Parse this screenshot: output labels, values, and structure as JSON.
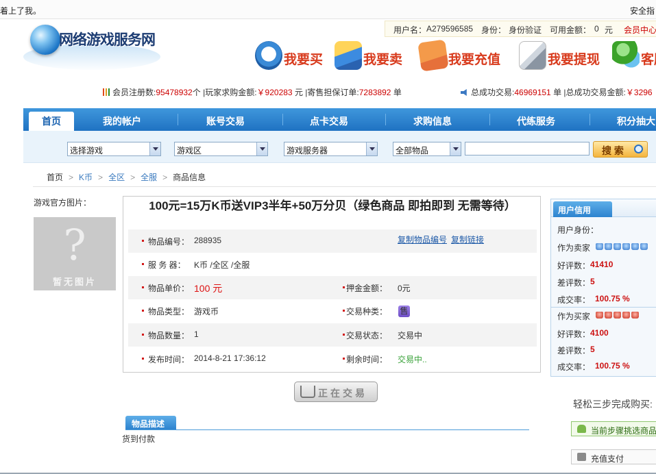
{
  "topbar": {
    "marquee": "着上了我。",
    "safety": "安全指"
  },
  "logo": {
    "name": "网络游戏服务网"
  },
  "user": {
    "username_label": "用户名：",
    "username": "A279596585",
    "identity_label": "身份：",
    "identity": "身份验证",
    "balance_label": "可用金额：",
    "balance": "0",
    "balance_unit": "元",
    "member_center": "会员中心"
  },
  "actions": [
    {
      "label": "我要买",
      "icon": "clock-dollar-icon"
    },
    {
      "label": "我要卖",
      "icon": "wallet-card-icon"
    },
    {
      "label": "我要充值",
      "icon": "id-card-icon"
    },
    {
      "label": "我要提现",
      "icon": "document-pen-icon"
    },
    {
      "label": "客服",
      "icon": "service-person-icon"
    }
  ],
  "stats": {
    "members_label": "会员注册数:",
    "members": "95478932",
    "members_unit": "个",
    "buy_label": "玩家求购金额:",
    "buy_amount": "￥920283",
    "buy_unit": "元",
    "escrow_label": "寄售担保订单:",
    "escrow": "7283892",
    "escrow_unit": "单",
    "success_label": "总成功交易:",
    "success": "46969151",
    "success_unit": "单",
    "success_amount_label": "总成功交易金额:",
    "success_amount": "￥3296"
  },
  "nav": [
    "首页",
    "我的帐户",
    "账号交易",
    "点卡交易",
    "求购信息",
    "代练服务",
    "积分抽大"
  ],
  "search": {
    "game": "选择游戏",
    "zone": "游戏区",
    "server": "游戏服务器",
    "category": "全部物品",
    "query": "",
    "button": "搜 索"
  },
  "breadcrumb": [
    "首页",
    "K币",
    "全区",
    "全服",
    "商品信息"
  ],
  "left": {
    "title": "游戏官方图片：",
    "placeholder_mark": "?",
    "placeholder_text": "暂无图片"
  },
  "item": {
    "title": "100元=15万K币送VIP3半年+50万分贝（绿色商品 即拍即到 无需等待）",
    "id_label": "物品编号：",
    "id": "288935",
    "copy_id": "复制物品编号",
    "copy_link": "复制链接",
    "server_label": "服 务 器：",
    "server": "K币 /全区 /全服",
    "price_label": "物品单价：",
    "price": "100 元",
    "deposit_label": "押金金额：",
    "deposit": "0元",
    "type_label": "物品类型：",
    "type": "游戏币",
    "trade_kind_label": "交易种类：",
    "trade_kind_icon": "售",
    "qty_label": "物品数量：",
    "qty": "1",
    "status_label": "交易状态：",
    "status": "交易中",
    "publish_label": "发布时间：",
    "publish": "2014-8-21 17:36:12",
    "remain_label": "剩余时间：",
    "remain": "交易中.."
  },
  "trade_button": "正在交易",
  "description": {
    "tab": "物品描述",
    "text": "货到付款"
  },
  "credit": {
    "tab": "用户信用",
    "identity_label": "用户身份：",
    "as_seller": "作为卖家",
    "good_label": "好评数：",
    "seller_good": "41410",
    "bad_label": "差评数：",
    "seller_bad": "5",
    "rate_label": "成交率：",
    "seller_rate": "100.75 %",
    "as_buyer": "作为买家",
    "buyer_good": "4100",
    "buyer_bad": "5",
    "buyer_rate": "100.75 %"
  },
  "steps": {
    "title": "轻松三步完成购买:",
    "current": "当前步骤挑选商品",
    "next": "充值支付"
  },
  "colors": {
    "nav_blue": "#1f72c2",
    "accent_red": "#cc0000",
    "action_red": "#d83a1c"
  }
}
